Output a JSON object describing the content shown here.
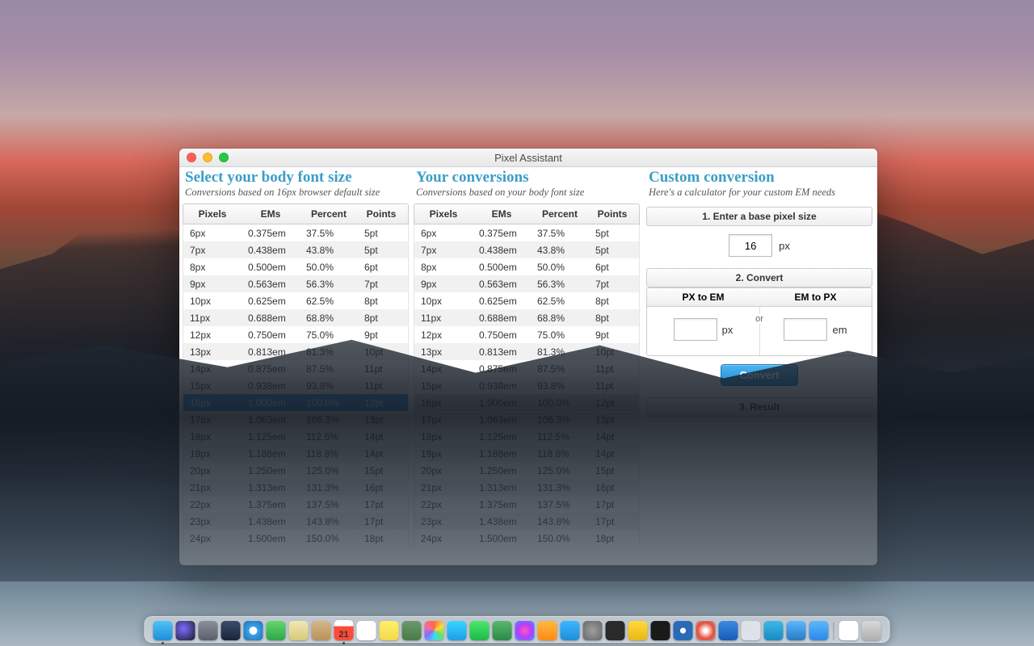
{
  "window_title": "Pixel Assistant",
  "col_a": {
    "title": "Select your body font size",
    "sub": "Conversions based on 16px browser default size"
  },
  "col_b": {
    "title": "Your conversions",
    "sub": "Conversions based on your body font size"
  },
  "col_c": {
    "title": "Custom conversion",
    "sub": "Here's a calculator for your custom EM needs"
  },
  "headers": {
    "pixels": "Pixels",
    "ems": "EMs",
    "percent": "Percent",
    "points": "Points"
  },
  "rows": [
    {
      "px": "6px",
      "em": "0.375em",
      "pct": "37.5%",
      "pt": "5pt"
    },
    {
      "px": "7px",
      "em": "0.438em",
      "pct": "43.8%",
      "pt": "5pt"
    },
    {
      "px": "8px",
      "em": "0.500em",
      "pct": "50.0%",
      "pt": "6pt"
    },
    {
      "px": "9px",
      "em": "0.563em",
      "pct": "56.3%",
      "pt": "7pt"
    },
    {
      "px": "10px",
      "em": "0.625em",
      "pct": "62.5%",
      "pt": "8pt"
    },
    {
      "px": "11px",
      "em": "0.688em",
      "pct": "68.8%",
      "pt": "8pt"
    },
    {
      "px": "12px",
      "em": "0.750em",
      "pct": "75.0%",
      "pt": "9pt"
    },
    {
      "px": "13px",
      "em": "0.813em",
      "pct": "81.3%",
      "pt": "10pt"
    },
    {
      "px": "14px",
      "em": "0.875em",
      "pct": "87.5%",
      "pt": "11pt"
    },
    {
      "px": "15px",
      "em": "0.938em",
      "pct": "93.8%",
      "pt": "11pt"
    },
    {
      "px": "16px",
      "em": "1.000em",
      "pct": "100.0%",
      "pt": "12pt",
      "sel": true
    },
    {
      "px": "17px",
      "em": "1.063em",
      "pct": "106.3%",
      "pt": "13pt"
    },
    {
      "px": "18px",
      "em": "1.125em",
      "pct": "112.5%",
      "pt": "14pt"
    },
    {
      "px": "19px",
      "em": "1.188em",
      "pct": "118.8%",
      "pt": "14pt"
    },
    {
      "px": "20px",
      "em": "1.250em",
      "pct": "125.0%",
      "pt": "15pt"
    },
    {
      "px": "21px",
      "em": "1.313em",
      "pct": "131.3%",
      "pt": "16pt"
    },
    {
      "px": "22px",
      "em": "1.375em",
      "pct": "137.5%",
      "pt": "17pt"
    },
    {
      "px": "23px",
      "em": "1.438em",
      "pct": "143.8%",
      "pt": "17pt"
    },
    {
      "px": "24px",
      "em": "1.500em",
      "pct": "150.0%",
      "pt": "18pt"
    }
  ],
  "step1": {
    "label": "1. Enter a base pixel size",
    "value": "16",
    "unit": "px"
  },
  "step2": {
    "label": "2. Convert",
    "px_to_em": "PX to EM",
    "em_to_px": "EM to PX",
    "px_unit": "px",
    "or": "or",
    "em_unit": "em",
    "button": "Convert"
  },
  "step3": {
    "label": "3. Result"
  },
  "dock": [
    {
      "name": "finder",
      "bg": "linear-gradient(#4ec2f7,#1e8ed8)",
      "running": true
    },
    {
      "name": "siri",
      "bg": "radial-gradient(circle at 40% 40%,#7b6cff,#1a1a2a)"
    },
    {
      "name": "launchpad",
      "bg": "linear-gradient(#8a8f99,#5a5f69)"
    },
    {
      "name": "mission-control",
      "bg": "linear-gradient(#3a4b6b,#1a2438)"
    },
    {
      "name": "safari",
      "bg": "radial-gradient(circle,#fff 28%,#3aa3e8 30%,#1e6fb8 100%)"
    },
    {
      "name": "numbers",
      "bg": "linear-gradient(#62d86b,#2fa64a)"
    },
    {
      "name": "mail",
      "bg": "linear-gradient(#f2e6b5,#d6c97a)"
    },
    {
      "name": "contacts",
      "bg": "linear-gradient(#d6b58a,#b8925a)"
    },
    {
      "name": "calendar",
      "bg": "linear-gradient(#fff 30%,#ff4a3a 30%)",
      "running": true
    },
    {
      "name": "reminders",
      "bg": "#fff"
    },
    {
      "name": "notes",
      "bg": "linear-gradient(#fff06a,#f2d94a)"
    },
    {
      "name": "keynote",
      "bg": "linear-gradient(#6a9a6a,#4a7a4a)"
    },
    {
      "name": "photos",
      "bg": "conic-gradient(#ff6a3a,#ffd93a,#6ae06a,#3ad9ff,#8a6aff,#ff6a9a,#ff6a3a)"
    },
    {
      "name": "messages",
      "bg": "linear-gradient(#3ad4ff,#1e9ee8)"
    },
    {
      "name": "facetime",
      "bg": "linear-gradient(#4ae86a,#1eb84a)"
    },
    {
      "name": "maps",
      "bg": "linear-gradient(#5ab86a,#2a8a4a)"
    },
    {
      "name": "itunes",
      "bg": "radial-gradient(circle,#ff5ab8,#b83aff,#3a9aff)"
    },
    {
      "name": "ibooks",
      "bg": "linear-gradient(#ffb83a,#ff8a1a)"
    },
    {
      "name": "appstore",
      "bg": "linear-gradient(#3ab8ff,#1e8ed8)"
    },
    {
      "name": "preferences",
      "bg": "radial-gradient(circle,#999 10%,#666 100%)"
    },
    {
      "name": "terminal",
      "bg": "#2a2a2a"
    },
    {
      "name": "console",
      "bg": "linear-gradient(#ffd83a,#e8b81a)"
    },
    {
      "name": "activity",
      "bg": "#1a1a1a"
    },
    {
      "name": "sourcetree",
      "bg": "radial-gradient(circle,#fff 20%,#2a6ab8 22%)"
    },
    {
      "name": "disc",
      "bg": "radial-gradient(circle,#fff 12%,#e84a3a 60%,#aaa 100%)"
    },
    {
      "name": "vscode",
      "bg": "linear-gradient(#3a8ae2,#1a5ab8)"
    },
    {
      "name": "textedit",
      "bg": "#dce2e8"
    },
    {
      "name": "xcode",
      "bg": "linear-gradient(#3ab8e8,#1a8ac2)"
    },
    {
      "name": "automator",
      "bg": "linear-gradient(#5ab8ff,#2a7ac2)"
    },
    {
      "name": "grab",
      "bg": "linear-gradient(#5ab8ff,#2a8ae2)"
    }
  ],
  "dock_right": [
    {
      "name": "document",
      "bg": "#fff"
    },
    {
      "name": "trash",
      "bg": "linear-gradient(#d8d8d8,#b0b0b0)"
    }
  ],
  "calendar_day": "21"
}
